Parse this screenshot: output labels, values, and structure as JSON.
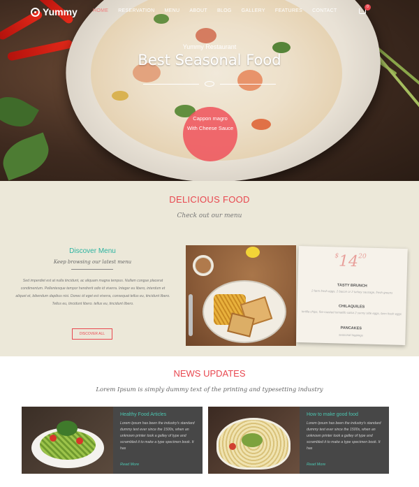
{
  "brand": {
    "name": "Yummy"
  },
  "nav": {
    "items": [
      "HOME",
      "RESERVATION",
      "MENU",
      "ABOUT",
      "BLOG",
      "GALLERY",
      "FEATURES",
      "CONTACT"
    ],
    "active": "HOME",
    "cart_count": "0"
  },
  "hero": {
    "subtitle": "Yummy Restaurant",
    "title": "Best Seasonal Food",
    "badge_line1": "Cappon magro",
    "badge_line2": "With Cheese Sauce"
  },
  "menu_section": {
    "title": "DELICIOUS FOOD",
    "subtitle": "Check out our menu",
    "discover": {
      "title": "Discover Menu",
      "subtitle": "Keep browsing our latest menu",
      "text": "Sed imperdiet est at nulla tincidunt, ac aliquam magna tempus. Nullam congue placerat condimentum. Pellentesque tempor hendrerit odio id viverra. Integer eu libero, interdum et aliquet et, bibendum dapibus nisi. Donec id eget est viverra, consequat tellus eu, tincidunt libero. Tellus eu, tincidunt libero. tellus eu, tincidunt libero.",
      "button": "DISCOVER ALL"
    },
    "card": {
      "price_main": "14",
      "price_cents": "20",
      "price_symbol": "$",
      "items": [
        {
          "name": "TASTY BRUNCH",
          "desc": "2 farm fresh eggs, 2 bacon or 2 turkey sausage, fresh greens"
        },
        {
          "name": "CHILAQUILES",
          "desc": "tortilla chips, fire-roasted tomatillo salsa 2 sunny side eggs, farm fresh eggs"
        },
        {
          "name": "PANCAKES",
          "desc": "seasonal toppings"
        }
      ]
    }
  },
  "news": {
    "title": "NEWS UPDATES",
    "subtitle": "Lorem Ipsum is simply dummy text of the printing and typesetting industry",
    "cards": [
      {
        "title": "Healthy Food Articles",
        "text": "Lorem Ipsum has been the industry's standard dummy text ever since the 1500s, when an unknown printer took a galley of type and scrambled it to make a type specimen book. It has",
        "more": "Read More"
      },
      {
        "title": "How to make good food",
        "text": "Lorem Ipsum has been the industry's standard dummy text ever since the 1500s, when an unknown printer took a galley of type and scrambled it to make a type specimen book. It has",
        "more": "Read More"
      }
    ]
  },
  "colors": {
    "accent": "#e8474f",
    "teal": "#2bb3a0",
    "menu_bg": "#ece8d9",
    "card_dark": "#474747"
  }
}
